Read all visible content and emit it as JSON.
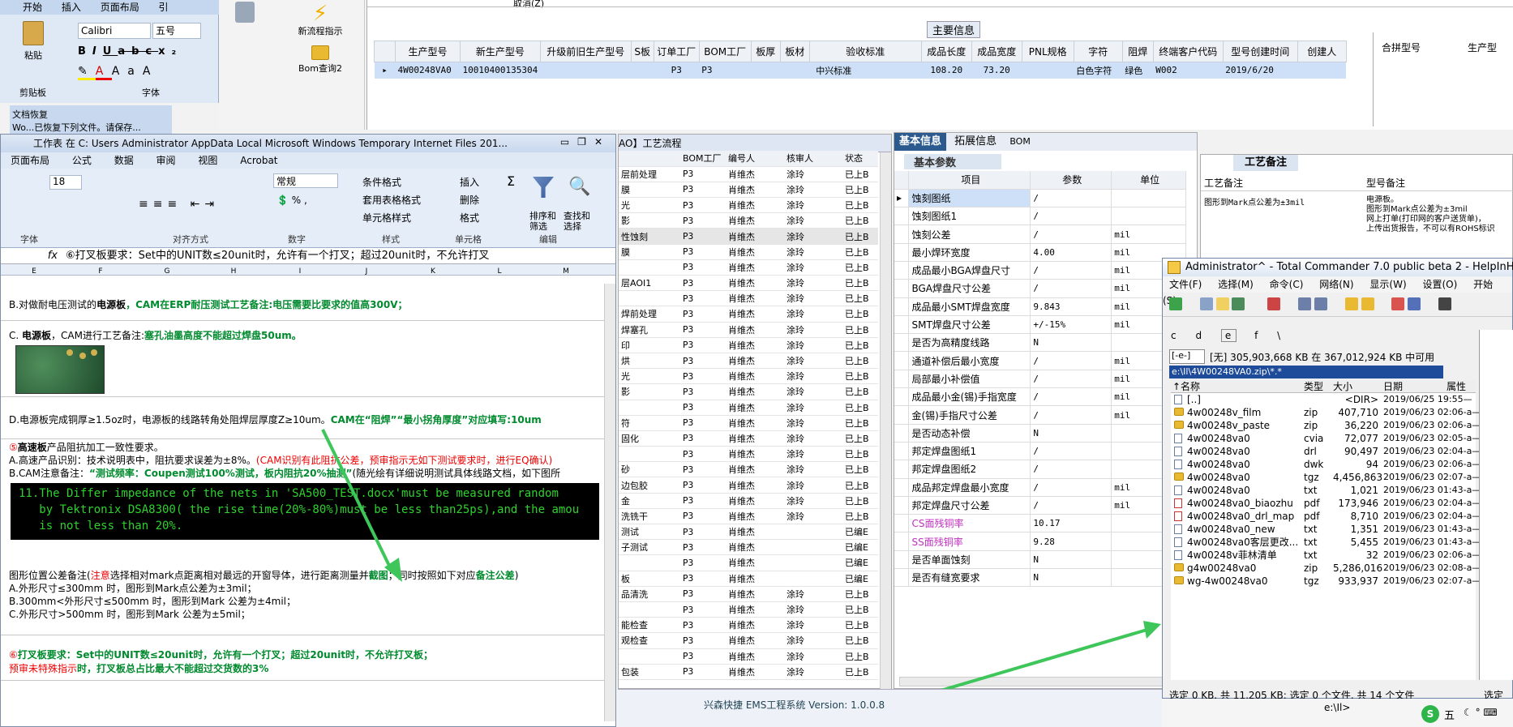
{
  "word_ribbon": {
    "tabs": [
      "开始",
      "插入",
      "页面布局",
      "引"
    ],
    "paste_label": "粘贴",
    "font_name": "Calibri",
    "font_size": "五号",
    "clipboard_label": "剪贴板",
    "font_group_label": "字体",
    "doc_recovery": "文档恢复",
    "doc_recovery_sub": "Wo...已恢复下列文件。请保存..."
  },
  "launcher": {
    "new_flow_label": "新流程指示",
    "bom_query_label": "Bom查询2"
  },
  "main_grid": {
    "top_text": "取消(Z)",
    "section_title": "主要信息",
    "columns": [
      "生产型号",
      "新生产型号",
      "升级前旧生产型号",
      "S板",
      "订单工厂",
      "BOM工厂",
      "板厚",
      "板材",
      "验收标准",
      "成品长度",
      "成品宽度",
      "PNL规格",
      "字符",
      "阻焊",
      "终端客户代码",
      "型号创建时间",
      "创建人"
    ],
    "row": [
      "4W00248VA0",
      "10010400135304",
      "",
      "",
      "P3",
      "P3",
      "",
      "",
      "中兴标准",
      "108.20",
      "73.20",
      "",
      "白色字符",
      "绿色",
      "W002",
      "2019/6/20",
      ""
    ],
    "right_columns": [
      "合拼型号",
      "生产型"
    ]
  },
  "excel": {
    "title": "工作表 在 C: Users Administrator AppData Local Microsoft Windows Temporary Internet Files 201...",
    "menu": [
      "页面布局",
      "公式",
      "数据",
      "审阅",
      "视图",
      "Acrobat"
    ],
    "font_size": "18",
    "number_format": "常规",
    "ribbon_items": {
      "conditional": "条件格式",
      "table_fmt": "套用表格格式",
      "cell_style": "单元格样式",
      "insert": "插入",
      "delete": "删除",
      "format": "格式",
      "sort": "排序和筛选",
      "find": "查找和选择"
    },
    "group_labels": [
      "字体",
      "对齐方式",
      "数字",
      "样式",
      "单元格",
      "编辑"
    ],
    "formula": "⑥打叉板要求：Set中的UNIT数≤20unit时，允许有一个打叉；超过20unit时，不允许打叉",
    "col_letters": [
      "E",
      "F",
      "G",
      "H",
      "I",
      "J",
      "K",
      "L",
      "M"
    ],
    "rows": {
      "r1a": "B.对做耐电压测试的",
      "r1b": "电源板",
      "r1c": "，CAM在ERP耐压测试工艺备注:电压需要比要求的值高300V；",
      "r2a": "C. ",
      "r2b": "电源板",
      "r2c": "，CAM进行工艺备注:",
      "r2d": "塞孔油墨高度不能超过焊盘50um。",
      "r3a": "D.电源板完成铜厚≥1.5oz时，电源板的线路转角处阻焊层厚度Z≥10um。",
      "r3b": "CAM在“阻焊”“最小拐角厚度”对应填写:10um",
      "r4a": "⑤",
      "r4b": "高速板",
      "r4c": "产品阻抗加工一致性要求。",
      "r5a": "A.高速产品识别：技术说明表中，阻抗要求误差为±8%。",
      "r5b": "(CAM识别有此阻抗公差，预审指示无如下测试要求时，进行EQ确认)",
      "r6a": "B.CAM注意备注：",
      "r6b": "“测试频率：Coupen测试100%测试，板内阻抗20%抽测”",
      "r6c": "(随光绘有详细说明测试具体线路文档，如下图所",
      "terminal": "11.The Differ impedance of the nets in 'SA500_TEST.docx'must be measured random\n   by Tektronix DSA8300( the rise time(20%-80%)must be less than25ps),and the amou\n   is not less than 20%.",
      "r7a": "图形位置公差备注(",
      "r7b": "注意",
      "r7c": "选择相对mark点距离相对最远的开窗导体，进行距离测量并",
      "r7d": "截图",
      "r7e": "；同时按照如下对应",
      "r7f": "备注公差",
      "r7g": ")",
      "r8": "A.外形尺寸≤300mm 时，图形到Mark点公差为±3mil；",
      "r9": "B.300mm<外形尺寸≤500mm 时，图形到Mark 公差为±4mil；",
      "r10": "C.外形尺寸>500mm 时，图形到Mark 公差为±5mil；",
      "r11a": "⑥",
      "r11b": "打叉板要求：Set中的UNIT数≤20unit时，允许有一个打叉；超过20unit时，不允许打叉板；",
      "r12a": "预审未特殊指示",
      "r12b": "时，打叉板总占比最大不能超过交货数的3%"
    }
  },
  "process": {
    "title": "AO】工艺流程",
    "headers": [
      "",
      "BOM工厂",
      "编号人",
      "核审人",
      "状态"
    ],
    "rows": [
      [
        "层前处理",
        "P3",
        "肖维杰",
        "涂玲",
        "已上B"
      ],
      [
        "膜",
        "P3",
        "肖维杰",
        "涂玲",
        "已上B"
      ],
      [
        "光",
        "P3",
        "肖维杰",
        "涂玲",
        "已上B"
      ],
      [
        "影",
        "P3",
        "肖维杰",
        "涂玲",
        "已上B"
      ],
      [
        "性蚀刻",
        "P3",
        "肖维杰",
        "涂玲",
        "已上B"
      ],
      [
        "膜",
        "P3",
        "肖维杰",
        "涂玲",
        "已上B"
      ],
      [
        "",
        "P3",
        "肖维杰",
        "涂玲",
        "已上B"
      ],
      [
        "层AOI1",
        "P3",
        "肖维杰",
        "涂玲",
        "已上B"
      ],
      [
        "",
        "P3",
        "肖维杰",
        "涂玲",
        "已上B"
      ],
      [
        "焊前处理",
        "P3",
        "肖维杰",
        "涂玲",
        "已上B"
      ],
      [
        "焊塞孔",
        "P3",
        "肖维杰",
        "涂玲",
        "已上B"
      ],
      [
        "印",
        "P3",
        "肖维杰",
        "涂玲",
        "已上B"
      ],
      [
        "烘",
        "P3",
        "肖维杰",
        "涂玲",
        "已上B"
      ],
      [
        "光",
        "P3",
        "肖维杰",
        "涂玲",
        "已上B"
      ],
      [
        "影",
        "P3",
        "肖维杰",
        "涂玲",
        "已上B"
      ],
      [
        "",
        "P3",
        "肖维杰",
        "涂玲",
        "已上B"
      ],
      [
        "符",
        "P3",
        "肖维杰",
        "涂玲",
        "已上B"
      ],
      [
        "固化",
        "P3",
        "肖维杰",
        "涂玲",
        "已上B"
      ],
      [
        "",
        "P3",
        "肖维杰",
        "涂玲",
        "已上B"
      ],
      [
        "砂",
        "P3",
        "肖维杰",
        "涂玲",
        "已上B"
      ],
      [
        "边包胶",
        "P3",
        "肖维杰",
        "涂玲",
        "已上B"
      ],
      [
        "金",
        "P3",
        "肖维杰",
        "涂玲",
        "已上B"
      ],
      [
        "洗铣干",
        "P3",
        "肖维杰",
        "涂玲",
        "已上B"
      ],
      [
        "测试",
        "P3",
        "肖维杰",
        "",
        "已编E"
      ],
      [
        "子测试",
        "P3",
        "肖维杰",
        "",
        "已编E"
      ],
      [
        "",
        "P3",
        "肖维杰",
        "",
        "已编E"
      ],
      [
        "板",
        "P3",
        "肖维杰",
        "",
        "已编E"
      ],
      [
        "品清洗",
        "P3",
        "肖维杰",
        "涂玲",
        "已上B"
      ],
      [
        "",
        "P3",
        "肖维杰",
        "涂玲",
        "已上B"
      ],
      [
        "能检查",
        "P3",
        "肖维杰",
        "涂玲",
        "已上B"
      ],
      [
        "观检查",
        "P3",
        "肖维杰",
        "涂玲",
        "已上B"
      ],
      [
        "",
        "P3",
        "肖维杰",
        "涂玲",
        "已上B"
      ],
      [
        "包装",
        "P3",
        "肖维杰",
        "涂玲",
        "已上B"
      ]
    ]
  },
  "basic_info": {
    "tabs": [
      "基本信息",
      "拓展信息",
      "BOM"
    ],
    "section": "基本参数",
    "headers": [
      "项目",
      "参数",
      "单位"
    ],
    "rows": [
      [
        "蚀刻图纸",
        "/",
        ""
      ],
      [
        "蚀刻图纸1",
        "/",
        ""
      ],
      [
        "蚀刻公差",
        "/",
        "mil"
      ],
      [
        "最小焊环宽度",
        "4.00",
        "mil"
      ],
      [
        "成品最小BGA焊盘尺寸",
        "/",
        "mil"
      ],
      [
        "BGA焊盘尺寸公差",
        "/",
        "mil"
      ],
      [
        "成品最小SMT焊盘宽度",
        "9.843",
        "mil"
      ],
      [
        "SMT焊盘尺寸公差",
        "+/-15%",
        "mil"
      ],
      [
        "是否为高精度线路",
        "N",
        ""
      ],
      [
        "通道补偿后最小宽度",
        "/",
        "mil"
      ],
      [
        "局部最小补偿值",
        "/",
        "mil"
      ],
      [
        "成品最小金(锡)手指宽度",
        "/",
        "mil"
      ],
      [
        "金(锡)手指尺寸公差",
        "/",
        "mil"
      ],
      [
        "是否动态补偿",
        "N",
        ""
      ],
      [
        "邦定焊盘图纸1",
        "/",
        ""
      ],
      [
        "邦定焊盘图纸2",
        "/",
        ""
      ],
      [
        "成品邦定焊盘最小宽度",
        "/",
        "mil"
      ],
      [
        "邦定焊盘尺寸公差",
        "/",
        "mil"
      ],
      [
        "CS面残铜率",
        "10.17",
        ""
      ],
      [
        "SS面残铜率",
        "9.28",
        ""
      ],
      [
        "是否单面蚀刻",
        "N",
        ""
      ],
      [
        "是否有缝宽要求",
        "N",
        ""
      ]
    ],
    "highlight_color": "#c030c0"
  },
  "remarks": {
    "tab": "工艺备注",
    "col1": "工艺备注",
    "col2": "型号备注",
    "text1": "图形到Mark点公差为±3mil",
    "text2": "电源板。\n图形到Mark点公差为±3mil\n网上打单(打印网的客户送货单)，\n上传出货报告，不可以有ROHS标识"
  },
  "tc": {
    "title": "Administrator^ - Total Commander 7.0 public beta 2 - HelpInHand",
    "menu": [
      "文件(F)",
      "选择(M)",
      "命令(C)",
      "网络(N)",
      "显示(W)",
      "设置(O)",
      "开始(S)"
    ],
    "drives": [
      "c",
      "d",
      "e",
      "f",
      "\\"
    ],
    "drive_select": "[-e-]",
    "disk_info": "[无] 305,903,668 KB 在 367,012,924 KB 中可用",
    "path": "e:\\Il\\4W00248VA0.zip\\*.*",
    "col_headers": [
      "↑名称",
      "类型",
      "大小",
      "日期",
      "属性"
    ],
    "files": [
      {
        "name": "[..]",
        "type": "",
        "size": "<DIR>",
        "date": "2019/06/25 19:55—",
        "kind": "up"
      },
      {
        "name": "4w00248v_film",
        "type": "zip",
        "size": "407,710",
        "date": "2019/06/23 02:06-a—",
        "kind": "folder"
      },
      {
        "name": "4w00248v_paste",
        "type": "zip",
        "size": "36,220",
        "date": "2019/06/23 02:06-a—",
        "kind": "folder"
      },
      {
        "name": "4w00248va0",
        "type": "cvia",
        "size": "72,077",
        "date": "2019/06/23 02:05-a—",
        "kind": "file"
      },
      {
        "name": "4w00248va0",
        "type": "drl",
        "size": "90,497",
        "date": "2019/06/23 02:04-a—",
        "kind": "file"
      },
      {
        "name": "4w00248va0",
        "type": "dwk",
        "size": "94",
        "date": "2019/06/23 02:06-a—",
        "kind": "file"
      },
      {
        "name": "4w00248va0",
        "type": "tgz",
        "size": "4,456,863",
        "date": "2019/06/23 02:07-a—",
        "kind": "folder"
      },
      {
        "name": "4w00248va0",
        "type": "txt",
        "size": "1,021",
        "date": "2019/06/23 01:43-a—",
        "kind": "file"
      },
      {
        "name": "4w00248va0_biaozhu",
        "type": "pdf",
        "size": "173,946",
        "date": "2019/06/23 02:04-a—",
        "kind": "pdf"
      },
      {
        "name": "4w00248va0_drl_map",
        "type": "pdf",
        "size": "8,710",
        "date": "2019/06/23 02:04-a—",
        "kind": "pdf"
      },
      {
        "name": "4w00248va0_new",
        "type": "txt",
        "size": "1,351",
        "date": "2019/06/23 01:43-a—",
        "kind": "file"
      },
      {
        "name": "4w00248va0客层更改...",
        "type": "txt",
        "size": "5,455",
        "date": "2019/06/23 01:43-a—",
        "kind": "file"
      },
      {
        "name": "4w00248v菲林清单",
        "type": "txt",
        "size": "32",
        "date": "2019/06/23 02:06-a—",
        "kind": "file"
      },
      {
        "name": "g4w00248va0",
        "type": "zip",
        "size": "5,286,016",
        "date": "2019/06/23 02:08-a—",
        "kind": "folder"
      },
      {
        "name": "wg-4w00248va0",
        "type": "tgz",
        "size": "933,937",
        "date": "2019/06/23 02:07-a—",
        "kind": "folder"
      }
    ],
    "status": "选定 0 KB. 共 11,205 KB: 选定 0 个文件. 共 14 个文件",
    "status_right": "选定",
    "cmd_path": "e:\\Il>"
  },
  "status_bar": {
    "version": "兴森快捷 EMS工程系统 Version: 1.0.0.8"
  },
  "taskbar": {
    "ime": "五"
  },
  "colors": {
    "green_text": "#008a2e",
    "red_text": "#e00000",
    "selection_blue": "#cde0f7",
    "arrow_green": "#3ec65a"
  }
}
